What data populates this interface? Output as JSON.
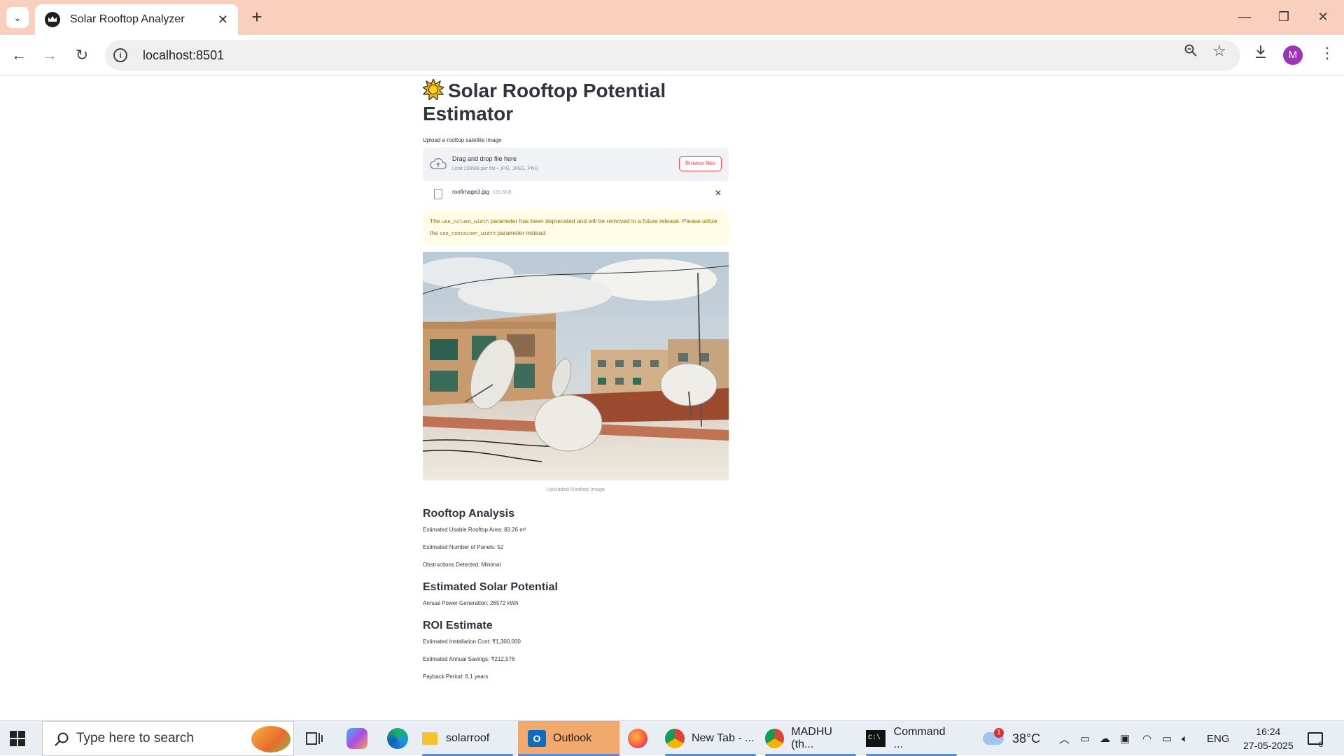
{
  "browser": {
    "tab_title": "Solar Rooftop Analyzer",
    "new_tab": "+",
    "url": "localhost:8501",
    "profile_initial": "M",
    "window_controls": {
      "minimize": "—",
      "restore": "❐",
      "close": "✕"
    }
  },
  "app": {
    "title": "Solar Rooftop Potential Estimator",
    "upload": {
      "label": "Upload a rooftop satellite image",
      "drag_text": "Drag and drop file here",
      "limit_text": "Limit 200MB per file • JPG, JPEG, PNG",
      "browse_label": "Browse files",
      "file_name": "roofimage3.jpg",
      "file_size": "159.6KB"
    },
    "warning": {
      "pre": "The",
      "code1": "use_column_width",
      "mid": "parameter has been deprecated and will be removed in a future release. Please utilize the",
      "code2": "use_container_width",
      "post": "parameter instead."
    },
    "image_caption": "Uploaded Rooftop Image",
    "rooftop": {
      "heading": "Rooftop Analysis",
      "area": "Estimated Usable Rooftop Area: 83.26 m²",
      "panels": "Estimated Number of Panels: 52",
      "obstructions": "Obstructions Detected: Minimal"
    },
    "solar": {
      "heading": "Estimated Solar Potential",
      "annual": "Annual Power Generation: 26572 kWh"
    },
    "roi": {
      "heading": "ROI Estimate",
      "cost": "Estimated Installation Cost: ₹1,300,000",
      "savings": "Estimated Annual Savings: ₹212,576",
      "payback": "Payback Period: 6.1 years"
    }
  },
  "taskbar": {
    "search_placeholder": "Type here to search",
    "apps": {
      "solarroof": "solarroof",
      "outlook": "Outlook",
      "chrome1": "New Tab - ...",
      "chrome2": "MADHU (th...",
      "cmd": "Command ..."
    },
    "weather_temp": "38°C",
    "weather_badge": "1",
    "language": "ENG",
    "time": "16:24",
    "date": "27-05-2025",
    "notifications": "8"
  }
}
